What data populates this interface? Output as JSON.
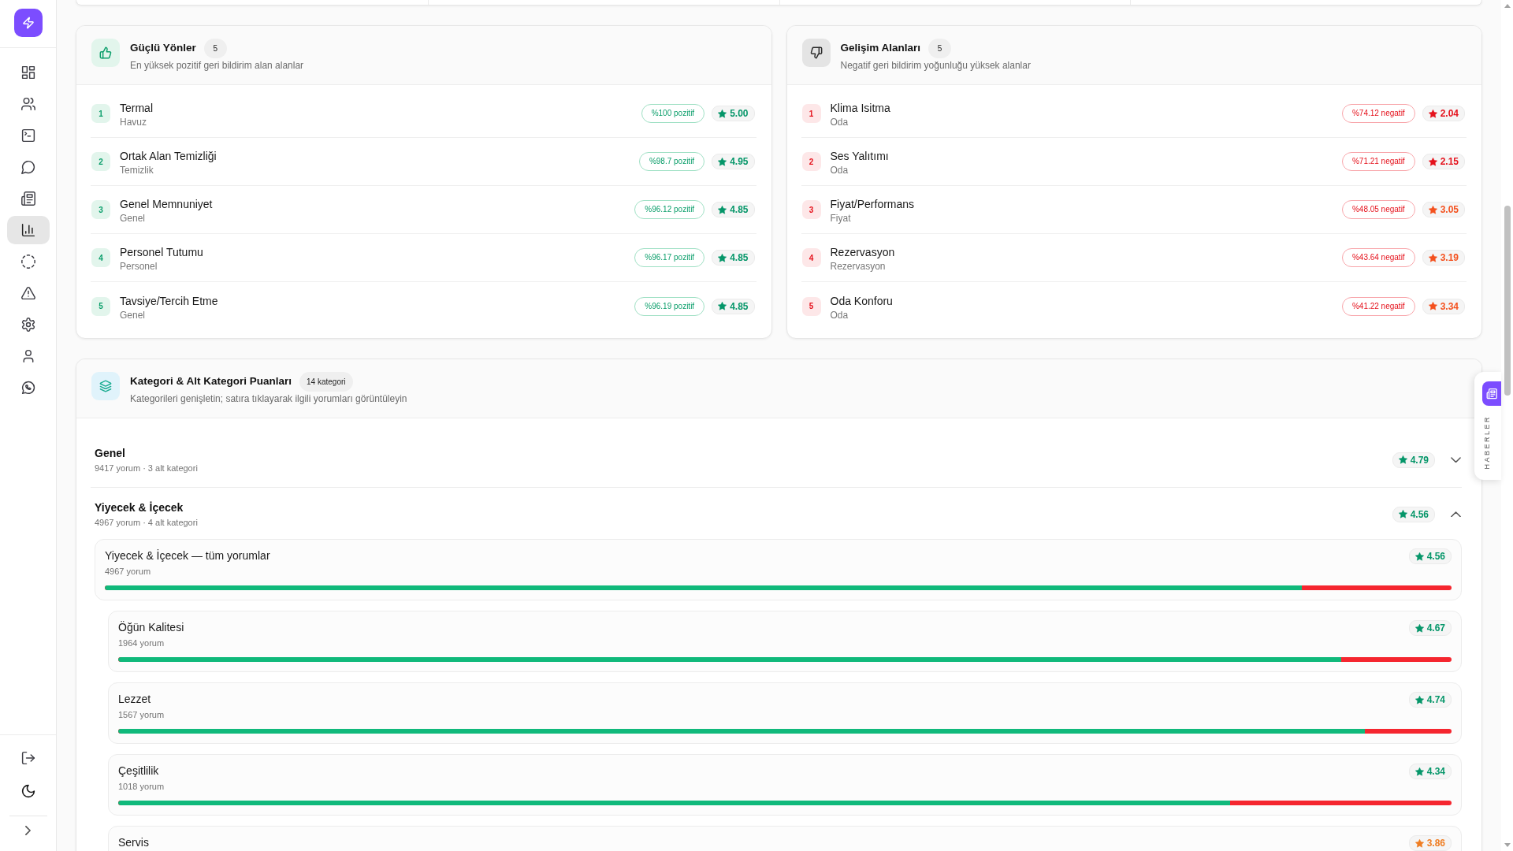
{
  "sidebar": {
    "items": [
      {
        "selected": false
      },
      {
        "selected": false
      },
      {
        "selected": false
      },
      {
        "selected": false
      },
      {
        "selected": false
      },
      {
        "selected": true
      },
      {
        "selected": false
      },
      {
        "selected": false
      },
      {
        "selected": false
      },
      {
        "selected": false
      },
      {
        "selected": false
      }
    ]
  },
  "highlights": [
    {
      "kind": "positive",
      "title": "Güçlü Yönler",
      "count": "5",
      "subtitle": "En yüksek pozitif geri bildirim alan alanlar",
      "items": [
        {
          "rank": "1",
          "name": "Termal",
          "category": "Havuz",
          "share": "%100 pozitif",
          "rating": "5.00",
          "color": "#059669"
        },
        {
          "rank": "2",
          "name": "Ortak Alan Temizliği",
          "category": "Temizlik",
          "share": "%98.7 pozitif",
          "rating": "4.95",
          "color": "#059669"
        },
        {
          "rank": "3",
          "name": "Genel Memnuniyet",
          "category": "Genel",
          "share": "%96.12 pozitif",
          "rating": "4.85",
          "color": "#059669"
        },
        {
          "rank": "4",
          "name": "Personel Tutumu",
          "category": "Personel",
          "share": "%96.17 pozitif",
          "rating": "4.85",
          "color": "#059669"
        },
        {
          "rank": "5",
          "name": "Tavsiye/Tercih Etme",
          "category": "Genel",
          "share": "%96.19 pozitif",
          "rating": "4.85",
          "color": "#059669"
        }
      ]
    },
    {
      "kind": "negative",
      "title": "Gelişim Alanları",
      "count": "5",
      "subtitle": "Negatif geri bildirim yoğunluğu yüksek alanlar",
      "items": [
        {
          "rank": "1",
          "name": "Klima Isitma",
          "category": "Oda",
          "share": "%74.12 negatif",
          "rating": "2.04",
          "color": "#e5121c"
        },
        {
          "rank": "2",
          "name": "Ses Yalıtımı",
          "category": "Oda",
          "share": "%71.21 negatif",
          "rating": "2.15",
          "color": "#e5121c"
        },
        {
          "rank": "3",
          "name": "Fiyat/Performans",
          "category": "Fiyat",
          "share": "%48.05 negatif",
          "rating": "3.05",
          "color": "#f4511e"
        },
        {
          "rank": "4",
          "name": "Rezervasyon",
          "category": "Rezervasyon",
          "share": "%43.64 negatif",
          "rating": "3.19",
          "color": "#f4511e"
        },
        {
          "rank": "5",
          "name": "Oda Konforu",
          "category": "Oda",
          "share": "%41.22 negatif",
          "rating": "3.34",
          "color": "#f4511e"
        }
      ]
    }
  ],
  "categories": {
    "title": "Kategori & Alt Kategori Puanları",
    "count": "14 kategori",
    "subtitle": "Kategorileri genişletin; satıra tıklayarak ilgili yorumları görüntüleyin",
    "groups": [
      {
        "name": "Genel",
        "meta": "9417 yorum · 3 alt kategori",
        "rating": "4.79",
        "color": "#059669",
        "expanded": false
      },
      {
        "name": "Yiyecek & İçecek",
        "meta": "4967 yorum · 4 alt kategori",
        "rating": "4.56",
        "color": "#059669",
        "expanded": true,
        "summary": {
          "name": "Yiyecek & İçecek — tüm yorumlar",
          "meta": "4967 yorum",
          "rating": "4.56",
          "color": "#059669",
          "level": 0.889
        },
        "subcategories": [
          {
            "name": "Öğün Kalitesi",
            "meta": "1964 yorum",
            "rating": "4.67",
            "color": "#059669",
            "level": 0.917
          },
          {
            "name": "Lezzet",
            "meta": "1567 yorum",
            "rating": "4.74",
            "color": "#059669",
            "level": 0.935
          },
          {
            "name": "Çeşitlilik",
            "meta": "1018 yorum",
            "rating": "4.34",
            "color": "#059669",
            "level": 0.834
          },
          {
            "name": "Servis",
            "rating": "3.86",
            "color": "#ef7d22"
          }
        ]
      }
    ]
  },
  "news_tab": {
    "label": "HABERLER"
  }
}
